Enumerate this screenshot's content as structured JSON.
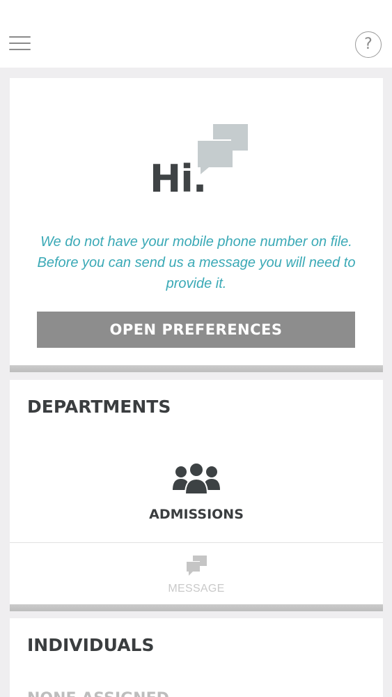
{
  "header": {
    "menu_icon": "hamburger-menu-icon",
    "help_icon": "question-mark-icon",
    "help_glyph": "?"
  },
  "greeting": {
    "title": "Hi.",
    "art_icon": "chat-bubbles-icon",
    "notice_line1": "We do not have your mobile phone number on file.",
    "notice_line2": "Before you can send us a message you will need to",
    "notice_line3": "provide it.",
    "button_label": "OPEN PREFERENCES"
  },
  "departments": {
    "title": "DEPARTMENTS",
    "items": [
      {
        "name": "ADMISSIONS",
        "icon": "group-people-icon"
      }
    ],
    "message_label": "MESSAGE",
    "message_icon": "chat-bubbles-icon"
  },
  "individuals": {
    "title": "INDIVIDUALS",
    "partial_text": "NONE ASSIGNED"
  },
  "colors": {
    "accent_text": "#3aa9b6",
    "button_bg": "#8d8d8d",
    "dark_text": "#3a3d3f",
    "bubble_gray": "#c5ccce"
  }
}
